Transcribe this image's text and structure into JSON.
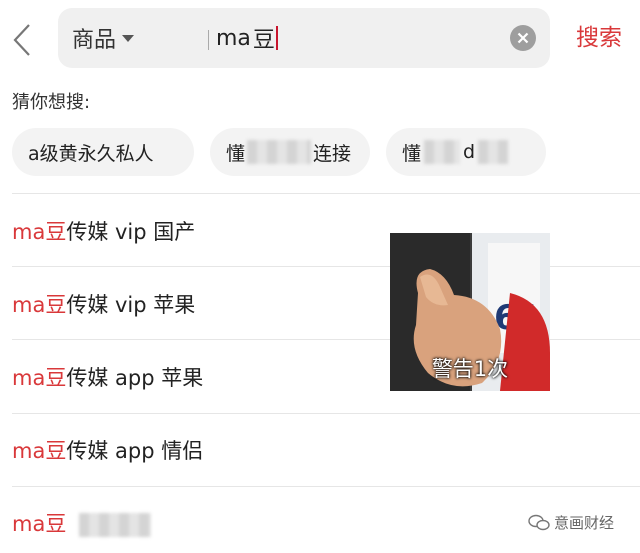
{
  "search": {
    "category": "商品",
    "query_prefix": "ma",
    "query_suffix": "豆",
    "button": "搜索"
  },
  "guess": {
    "title": "猜你想搜:",
    "chips": [
      {
        "before": "a级黄永久私人",
        "after": ""
      },
      {
        "before": "懂",
        "after": "连接"
      },
      {
        "before": "懂",
        "after": "d"
      }
    ]
  },
  "suggestions": [
    {
      "highlight": "ma豆",
      "rest": "传媒 vip 国产"
    },
    {
      "highlight": "ma豆",
      "rest": "传媒 vip 苹果"
    },
    {
      "highlight": "ma豆",
      "rest": "传媒 app 苹果"
    },
    {
      "highlight": "ma豆",
      "rest": "传媒 app 情侣"
    },
    {
      "highlight": "ma豆",
      "rest": ""
    }
  ],
  "meme": {
    "caption": "警告1次",
    "bib_number": "61"
  },
  "watermark": {
    "text": "意画财经"
  },
  "colors": {
    "accent": "#d9383a",
    "search_bg": "#f0f0f0",
    "chip_bg": "#f3f3f3"
  },
  "icons": [
    "back-arrow-icon",
    "dropdown-caret-icon",
    "clear-icon",
    "wechat-icon"
  ]
}
